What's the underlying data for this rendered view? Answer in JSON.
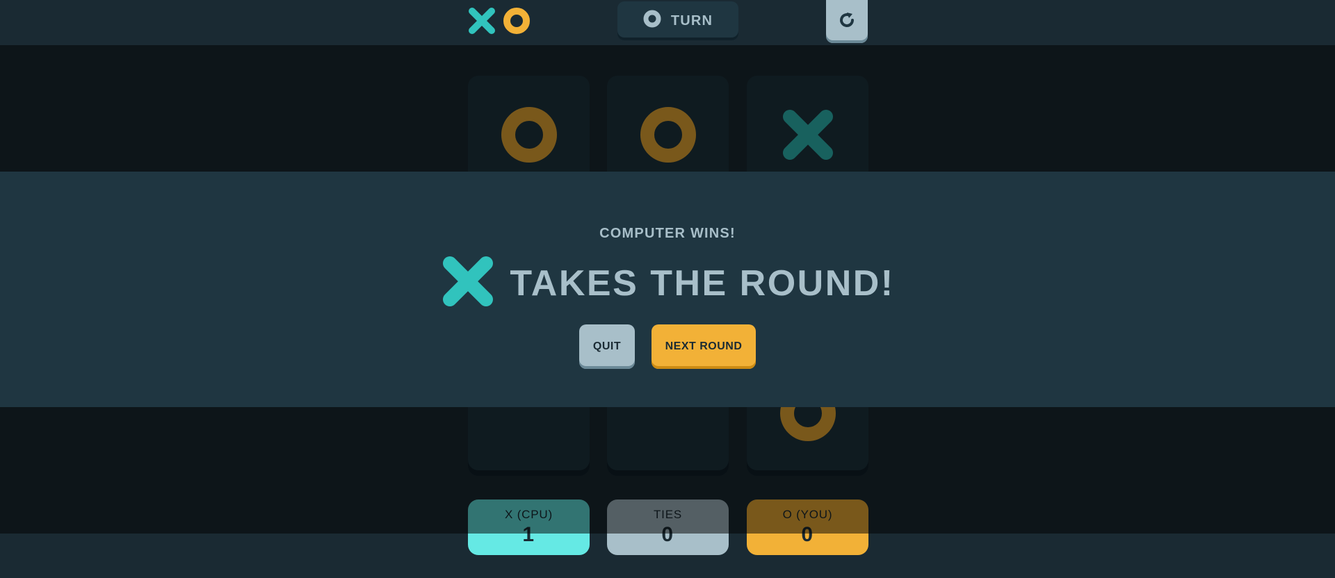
{
  "header": {
    "logo_icons": [
      "x-mark-icon",
      "o-mark-icon"
    ],
    "turn_label": "TURN",
    "turn_icon": "o-mark-icon",
    "restart_icon": "restart-icon"
  },
  "board": {
    "cells": [
      "O",
      "O",
      "X",
      "",
      "",
      "",
      "",
      "",
      "O"
    ]
  },
  "scores": [
    {
      "label": "X (CPU)",
      "value": "1"
    },
    {
      "label": "TIES",
      "value": "0"
    },
    {
      "label": "O (YOU)",
      "value": "0"
    }
  ],
  "modal": {
    "subtitle": "COMPUTER WINS!",
    "winner_icon": "x-mark-icon",
    "title": "TAKES THE ROUND!",
    "quit_label": "QUIT",
    "next_label": "NEXT ROUND"
  },
  "colors": {
    "x": "#31C3BD",
    "o": "#F2B137",
    "silver": "#A8BFC9",
    "navy": "#1A2A33",
    "semi_navy": "#1F3641",
    "x_score_bg": "#65E9E4"
  }
}
